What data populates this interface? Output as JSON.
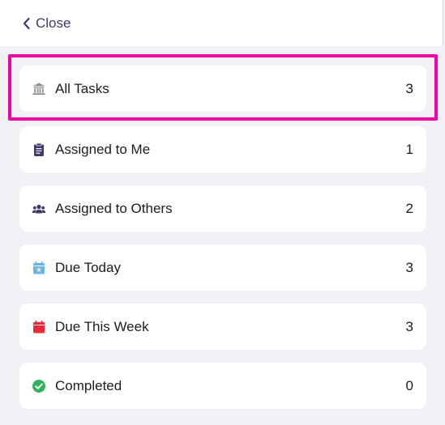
{
  "header": {
    "close_label": "Close"
  },
  "colors": {
    "accent": "#3c3a6b",
    "highlight": "#f200a8",
    "due_today": "#6ab7e6",
    "due_week": "#ee2a3a",
    "completed": "#2fb35a"
  },
  "list": {
    "items": [
      {
        "label": "All Tasks",
        "count": "3",
        "icon": "bank-icon",
        "selected": true
      },
      {
        "label": "Assigned to Me",
        "count": "1",
        "icon": "clipboard-icon"
      },
      {
        "label": "Assigned to Others",
        "count": "2",
        "icon": "group-icon"
      },
      {
        "label": "Due Today",
        "count": "3",
        "icon": "calendar-star-icon"
      },
      {
        "label": "Due This Week",
        "count": "3",
        "icon": "calendar-icon"
      },
      {
        "label": "Completed",
        "count": "0",
        "icon": "check-circle-icon"
      }
    ]
  }
}
